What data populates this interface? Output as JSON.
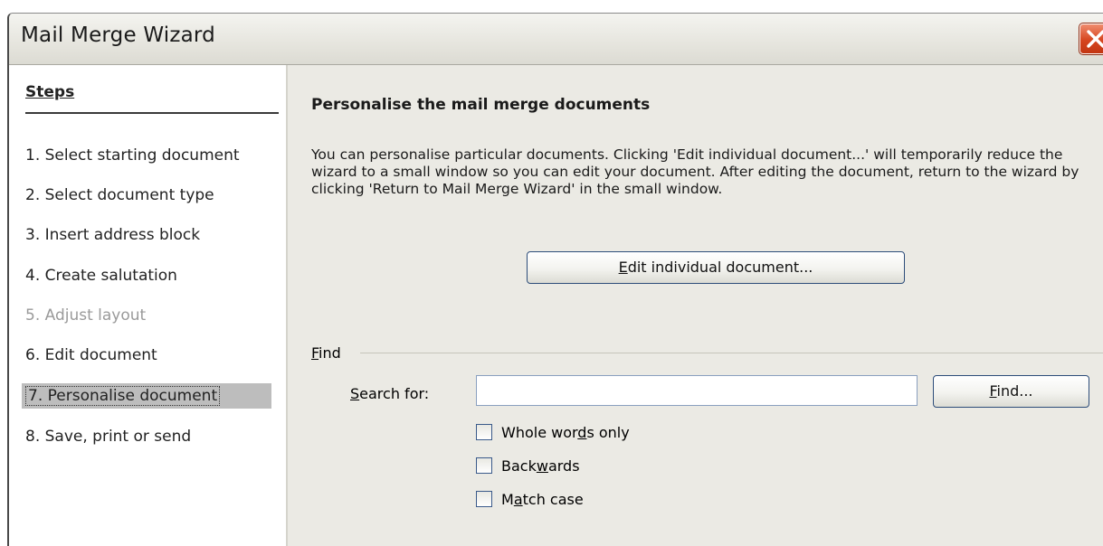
{
  "window": {
    "title": "Mail Merge Wizard"
  },
  "sidebar": {
    "heading": "Steps",
    "steps": [
      {
        "label": "1. Select starting document",
        "state": "normal"
      },
      {
        "label": "2. Select document type",
        "state": "normal"
      },
      {
        "label": "3. Insert address block",
        "state": "normal"
      },
      {
        "label": "4. Create salutation",
        "state": "normal"
      },
      {
        "label": "5. Adjust layout",
        "state": "disabled"
      },
      {
        "label": "6. Edit document",
        "state": "normal"
      },
      {
        "label": "7. Personalise document",
        "state": "active"
      },
      {
        "label": "8. Save, print or send",
        "state": "normal"
      }
    ]
  },
  "main": {
    "heading": "Personalise the mail merge documents",
    "description": "You can personalise particular documents. Clicking 'Edit individual document...' will temporarily reduce the wizard to a small window so you can edit your document. After editing the document, return to the wizard by clicking 'Return to Mail Merge Wizard' in the small window.",
    "edit_button": {
      "mnemonic": "E",
      "rest": "dit individual document..."
    },
    "find": {
      "group_mnemonic": "F",
      "group_rest": "ind",
      "search_label_mnemonic": "S",
      "search_label_rest": "earch for:",
      "search_value": "",
      "find_button_mnemonic": "F",
      "find_button_rest": "ind...",
      "options": [
        {
          "pre": "Whole wor",
          "mn": "d",
          "post": "s only",
          "checked": false
        },
        {
          "pre": "Back",
          "mn": "w",
          "post": "ards",
          "checked": false
        },
        {
          "pre": "M",
          "mn": "a",
          "post": "tch case",
          "checked": false
        }
      ]
    }
  },
  "icons": {
    "close": "close-icon"
  },
  "colors": {
    "close_red": "#d6451f",
    "active_step": "#bdbdbd",
    "button_border": "#2d4d7a"
  }
}
